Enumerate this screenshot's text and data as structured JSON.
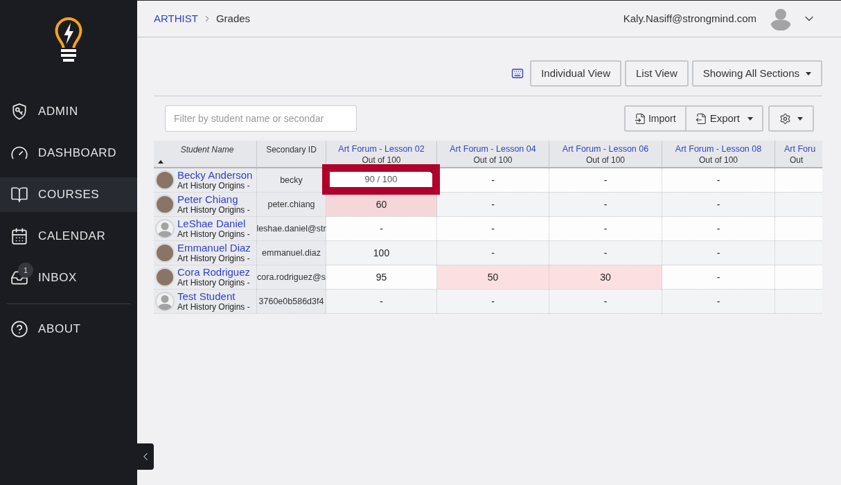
{
  "sidebar": {
    "items": [
      {
        "label": "ADMIN",
        "selected": false
      },
      {
        "label": "DASHBOARD",
        "selected": false
      },
      {
        "label": "COURSES",
        "selected": true
      },
      {
        "label": "CALENDAR",
        "selected": false
      },
      {
        "label": "INBOX",
        "selected": false,
        "badge": "1"
      }
    ],
    "footer_items": [
      {
        "label": "ABOUT",
        "selected": false
      }
    ]
  },
  "breadcrumb": {
    "parent": "ARTHIST",
    "current": "Grades"
  },
  "user": {
    "email": "Kaly.Nasiff@strongmind.com"
  },
  "toolbar": {
    "buttons": [
      {
        "label": "Individual View",
        "dropdown": false
      },
      {
        "label": "List View",
        "dropdown": false
      },
      {
        "label": "Showing All Sections",
        "dropdown": true
      }
    ]
  },
  "filter": {
    "placeholder": "Filter by student name or secondar"
  },
  "actions": {
    "import": "Import",
    "export": "Export"
  },
  "table": {
    "columns": [
      {
        "kind": "student",
        "label": "Student Name",
        "sorted": true
      },
      {
        "kind": "id",
        "label": "Secondary ID"
      },
      {
        "kind": "assignment",
        "label": "Art Forum - Lesson 02",
        "sublabel": "Out of 100"
      },
      {
        "kind": "assignment",
        "label": "Art Forum - Lesson 04",
        "sublabel": "Out of 100"
      },
      {
        "kind": "assignment",
        "label": "Art Forum - Lesson 06",
        "sublabel": "Out of 100"
      },
      {
        "kind": "assignment",
        "label": "Art Forum - Lesson 08",
        "sublabel": "Out of 100"
      },
      {
        "kind": "assignment",
        "label": "Art Foru",
        "sublabel": "Out"
      }
    ],
    "rows": [
      {
        "name": "Becky Anderson",
        "course": "Art History Origins -",
        "has_photo": true,
        "secondary_id": "becky",
        "grades": [
          {
            "value": "90 / 100",
            "editing": true,
            "flagged": false
          },
          {
            "value": "-",
            "editing": false,
            "flagged": false
          },
          {
            "value": "-",
            "editing": false,
            "flagged": false
          },
          {
            "value": "-",
            "editing": false,
            "flagged": false
          }
        ]
      },
      {
        "name": "Peter Chiang",
        "course": "Art History Origins -",
        "has_photo": true,
        "secondary_id": "peter.chiang",
        "grades": [
          {
            "value": "60",
            "editing": false,
            "flagged": true
          },
          {
            "value": "-",
            "editing": false,
            "flagged": false
          },
          {
            "value": "-",
            "editing": false,
            "flagged": false
          },
          {
            "value": "-",
            "editing": false,
            "flagged": false
          }
        ]
      },
      {
        "name": "LeShae Daniel",
        "course": "Art History Origins -",
        "has_photo": false,
        "secondary_id": "leshae.daniel@str",
        "grades": [
          {
            "value": "-",
            "editing": false,
            "flagged": false
          },
          {
            "value": "-",
            "editing": false,
            "flagged": false
          },
          {
            "value": "-",
            "editing": false,
            "flagged": false
          },
          {
            "value": "-",
            "editing": false,
            "flagged": false
          }
        ]
      },
      {
        "name": "Emmanuel Diaz",
        "course": "Art History Origins -",
        "has_photo": true,
        "secondary_id": "emmanuel.diaz",
        "grades": [
          {
            "value": "100",
            "editing": false,
            "flagged": false
          },
          {
            "value": "-",
            "editing": false,
            "flagged": false
          },
          {
            "value": "-",
            "editing": false,
            "flagged": false
          },
          {
            "value": "-",
            "editing": false,
            "flagged": false
          }
        ]
      },
      {
        "name": "Cora Rodriguez",
        "course": "Art History Origins -",
        "has_photo": true,
        "secondary_id": "cora.rodriguez@s",
        "grades": [
          {
            "value": "95",
            "editing": false,
            "flagged": false
          },
          {
            "value": "50",
            "editing": false,
            "flagged": true
          },
          {
            "value": "30",
            "editing": false,
            "flagged": true
          },
          {
            "value": "-",
            "editing": false,
            "flagged": false
          }
        ]
      },
      {
        "name": "Test Student",
        "course": "Art History Origins -",
        "has_photo": false,
        "secondary_id": "3760e0b586d3f4",
        "grades": [
          {
            "value": "-",
            "editing": false,
            "flagged": false
          },
          {
            "value": "-",
            "editing": false,
            "flagged": false
          },
          {
            "value": "-",
            "editing": false,
            "flagged": false
          },
          {
            "value": "-",
            "editing": false,
            "flagged": false
          }
        ]
      }
    ]
  }
}
